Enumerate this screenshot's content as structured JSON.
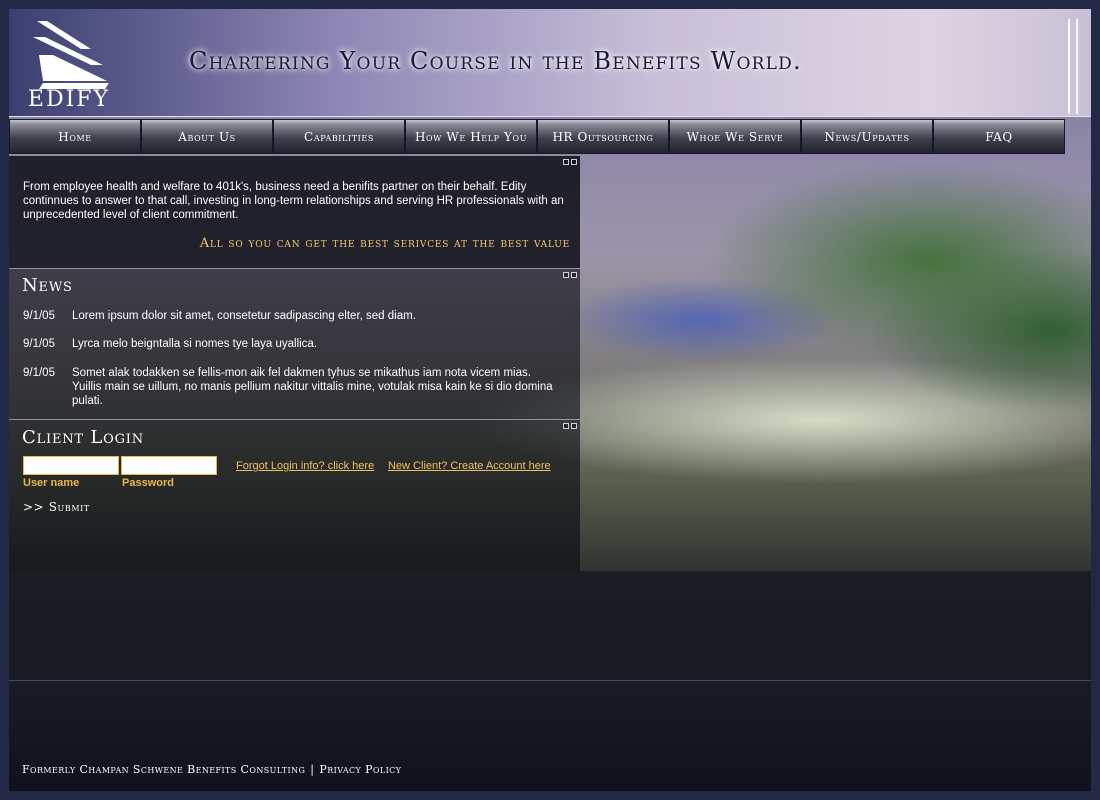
{
  "brand": {
    "name": "EDIFY",
    "tagline": "Chartering Your Course in the Benefits World."
  },
  "nav": [
    {
      "label": "Home"
    },
    {
      "label": "About Us"
    },
    {
      "label": "Capabilities"
    },
    {
      "label": "How We Help You"
    },
    {
      "label": "HR Outsourcing"
    },
    {
      "label": "Whoe We Serve"
    },
    {
      "label": "News/Updates"
    },
    {
      "label": "FAQ"
    }
  ],
  "intro": {
    "text": "From employee health and welfare to 401k's, business need a benifits partner on their behalf. Edity continnues to answer to that call, investing in long-term relationships and serving HR professionals with an unprecedented level of client commitment.",
    "slogan": "All so you can get the best serivces at the best value"
  },
  "news": {
    "title": "News",
    "items": [
      {
        "date": "9/1/05",
        "text": "Lorem ipsum dolor sit amet, consetetur sadipascing elter, sed diam."
      },
      {
        "date": "9/1/05",
        "text": "Lyrca melo beigntalla si nomes tye laya uyallica."
      },
      {
        "date": "9/1/05",
        "text": "Somet alak todakken se fellis-mon aik fel dakmen tyhus se mikathus iam nota vicem mias. Yuillis main se uillum, no manis pellium nakitur vittalis mine, votulak misa kain ke si dio domina pulati."
      }
    ]
  },
  "login": {
    "title": "Client Login",
    "username_label": "User name",
    "password_label": "Password",
    "username_value": "",
    "password_value": "",
    "forgot_link": "Forgot Login info? click here",
    "new_client_link": "New Client? Create Account here",
    "submit_label": ">> Submit"
  },
  "footer": {
    "former_name": "Formerly Champan Schwene Benefits Consulting",
    "separator": "|",
    "privacy": "Privacy Policy"
  },
  "colors": {
    "accent_gold": "#f0c870",
    "link_gold": "#f0c060",
    "frame": "#232846"
  },
  "icons": {
    "logo": "edify-stacked-chevron-logo",
    "panel_controls": "panel-window-buttons"
  }
}
